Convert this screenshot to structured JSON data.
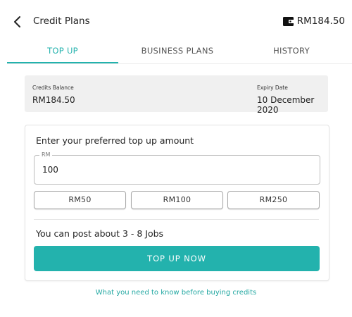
{
  "header": {
    "title": "Credit Plans",
    "wallet_balance": "RM184.50",
    "back_icon": "chevron-left-icon",
    "wallet_icon": "wallet-icon"
  },
  "tabs": [
    {
      "label": "TOP UP",
      "active": true
    },
    {
      "label": "BUSINESS PLANS",
      "active": false
    },
    {
      "label": "HISTORY",
      "active": false
    }
  ],
  "balance": {
    "credits_label": "Credits Balance",
    "credits_value": "RM184.50",
    "expiry_label": "Expiry Date",
    "expiry_value": "10 December 2020"
  },
  "topup": {
    "heading": "Enter your preferred top up amount",
    "field_label": "RM",
    "field_value": "100",
    "quick_amounts": [
      "RM50",
      "RM100",
      "RM250"
    ],
    "estimate_text": "You can post about 3 - 8 Jobs",
    "cta_label": "TOP UP NOW"
  },
  "footer_link": "What you need to know before buying credits",
  "colors": {
    "accent": "#23b2ad",
    "balance_bg": "#f0f0f0",
    "text": "#222222"
  }
}
